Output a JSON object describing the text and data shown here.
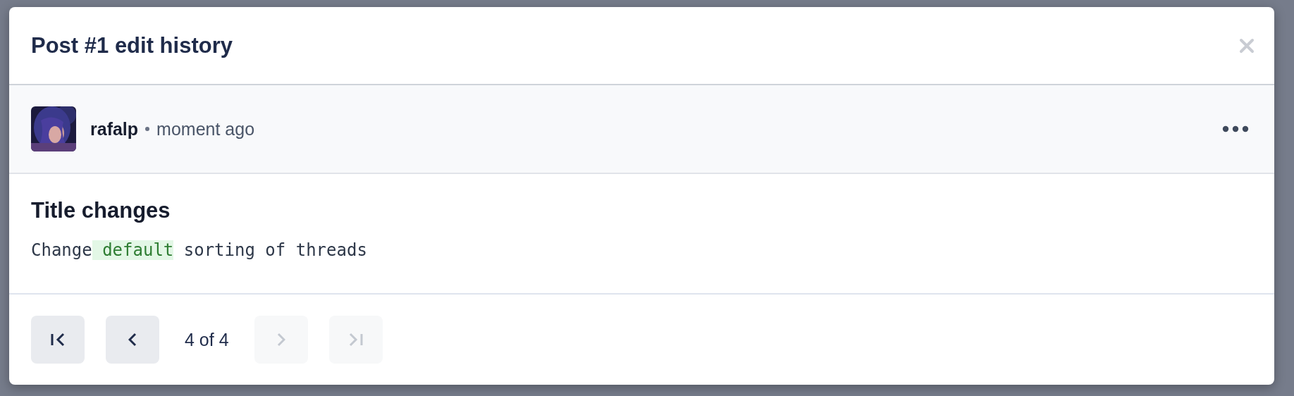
{
  "dialog": {
    "title": "Post #1 edit history"
  },
  "revision": {
    "author": "rafalp",
    "time": "moment ago"
  },
  "change": {
    "heading": "Title changes",
    "segments": [
      {
        "text": "Change",
        "kind": "same"
      },
      {
        "text": " default",
        "kind": "added"
      },
      {
        "text": " sorting of threads",
        "kind": "same"
      }
    ]
  },
  "pagination": {
    "label": "4 of 4",
    "buttons": [
      {
        "kind": "first",
        "disabled": false
      },
      {
        "kind": "previous",
        "disabled": false
      },
      {
        "kind": "next",
        "disabled": true
      },
      {
        "kind": "last",
        "disabled": true
      }
    ]
  }
}
